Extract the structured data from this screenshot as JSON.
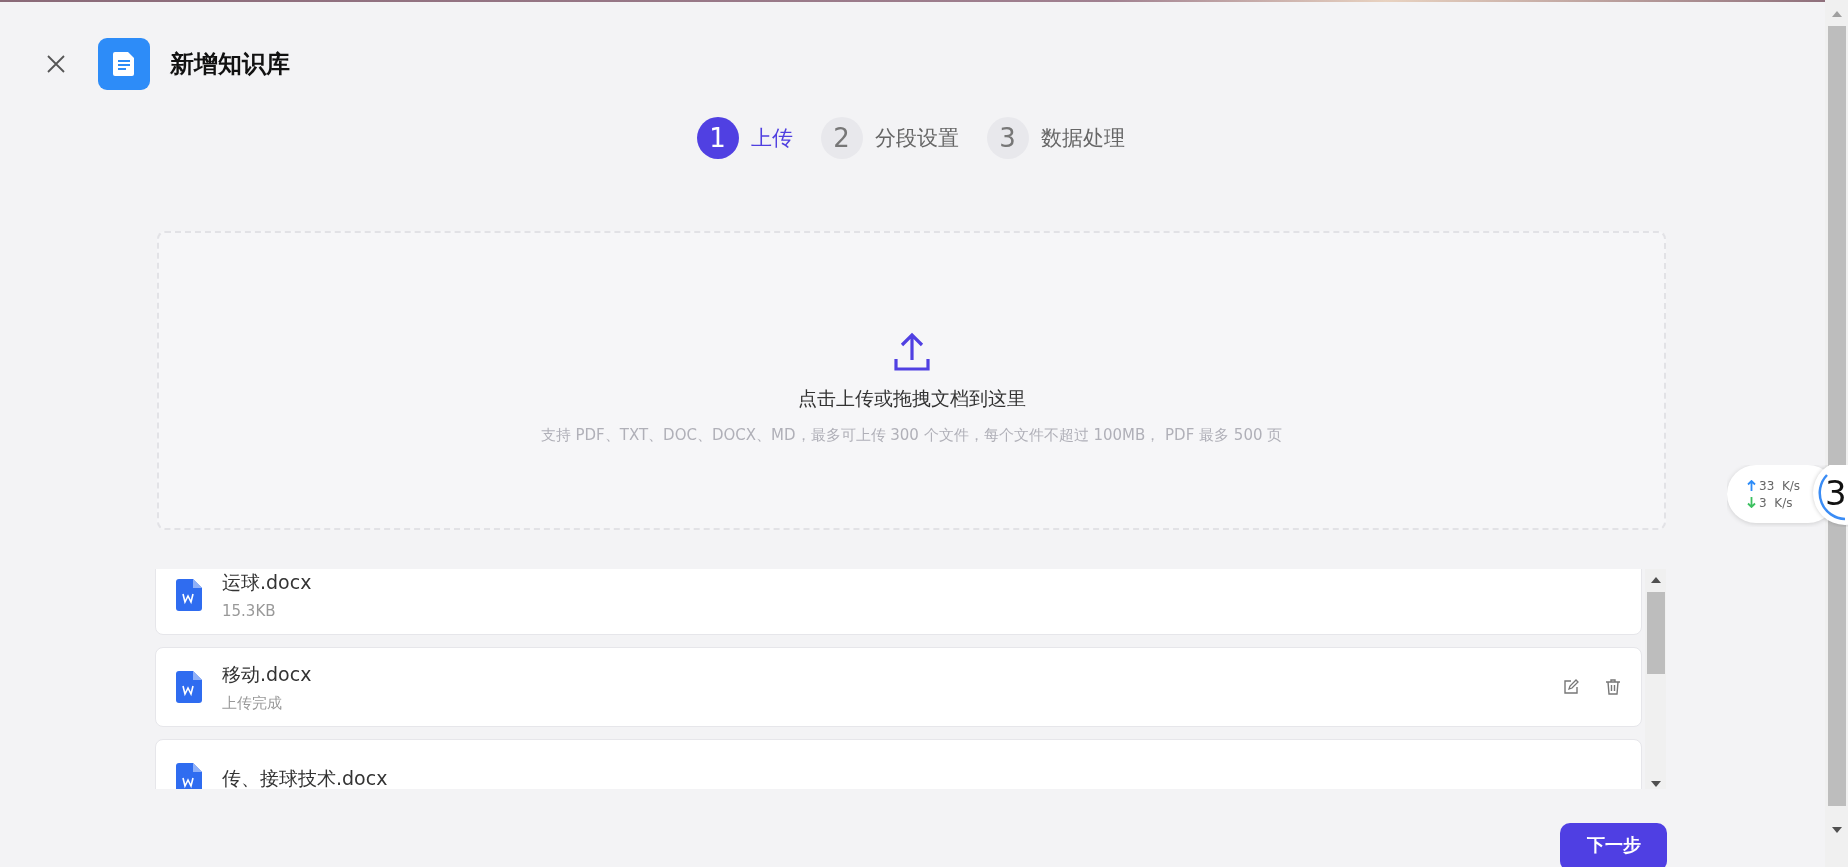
{
  "header": {
    "title": "新增知识库"
  },
  "steps": [
    {
      "number": "1",
      "label": "上传",
      "selected": true
    },
    {
      "number": "2",
      "label": "分段设置",
      "selected": false
    },
    {
      "number": "3",
      "label": "数据处理",
      "selected": false
    }
  ],
  "upload": {
    "prompt": "点击上传或拖拽文档到这里",
    "hint": "支持 PDF、TXT、DOC、DOCX、MD，最多可上传 300 个文件，每个文件不超过 100MB， PDF 最多 500 页"
  },
  "files": [
    {
      "name": "运球.docx",
      "info": "15.3KB",
      "hovered": false
    },
    {
      "name": "移动.docx",
      "info": "上传完成",
      "hovered": true
    },
    {
      "name": "传、接球技术.docx",
      "hovered": false
    }
  ],
  "next_button": "下一步",
  "speed_widget": {
    "upload": "33  K/s",
    "download": "3  K/s",
    "badge": "3"
  }
}
